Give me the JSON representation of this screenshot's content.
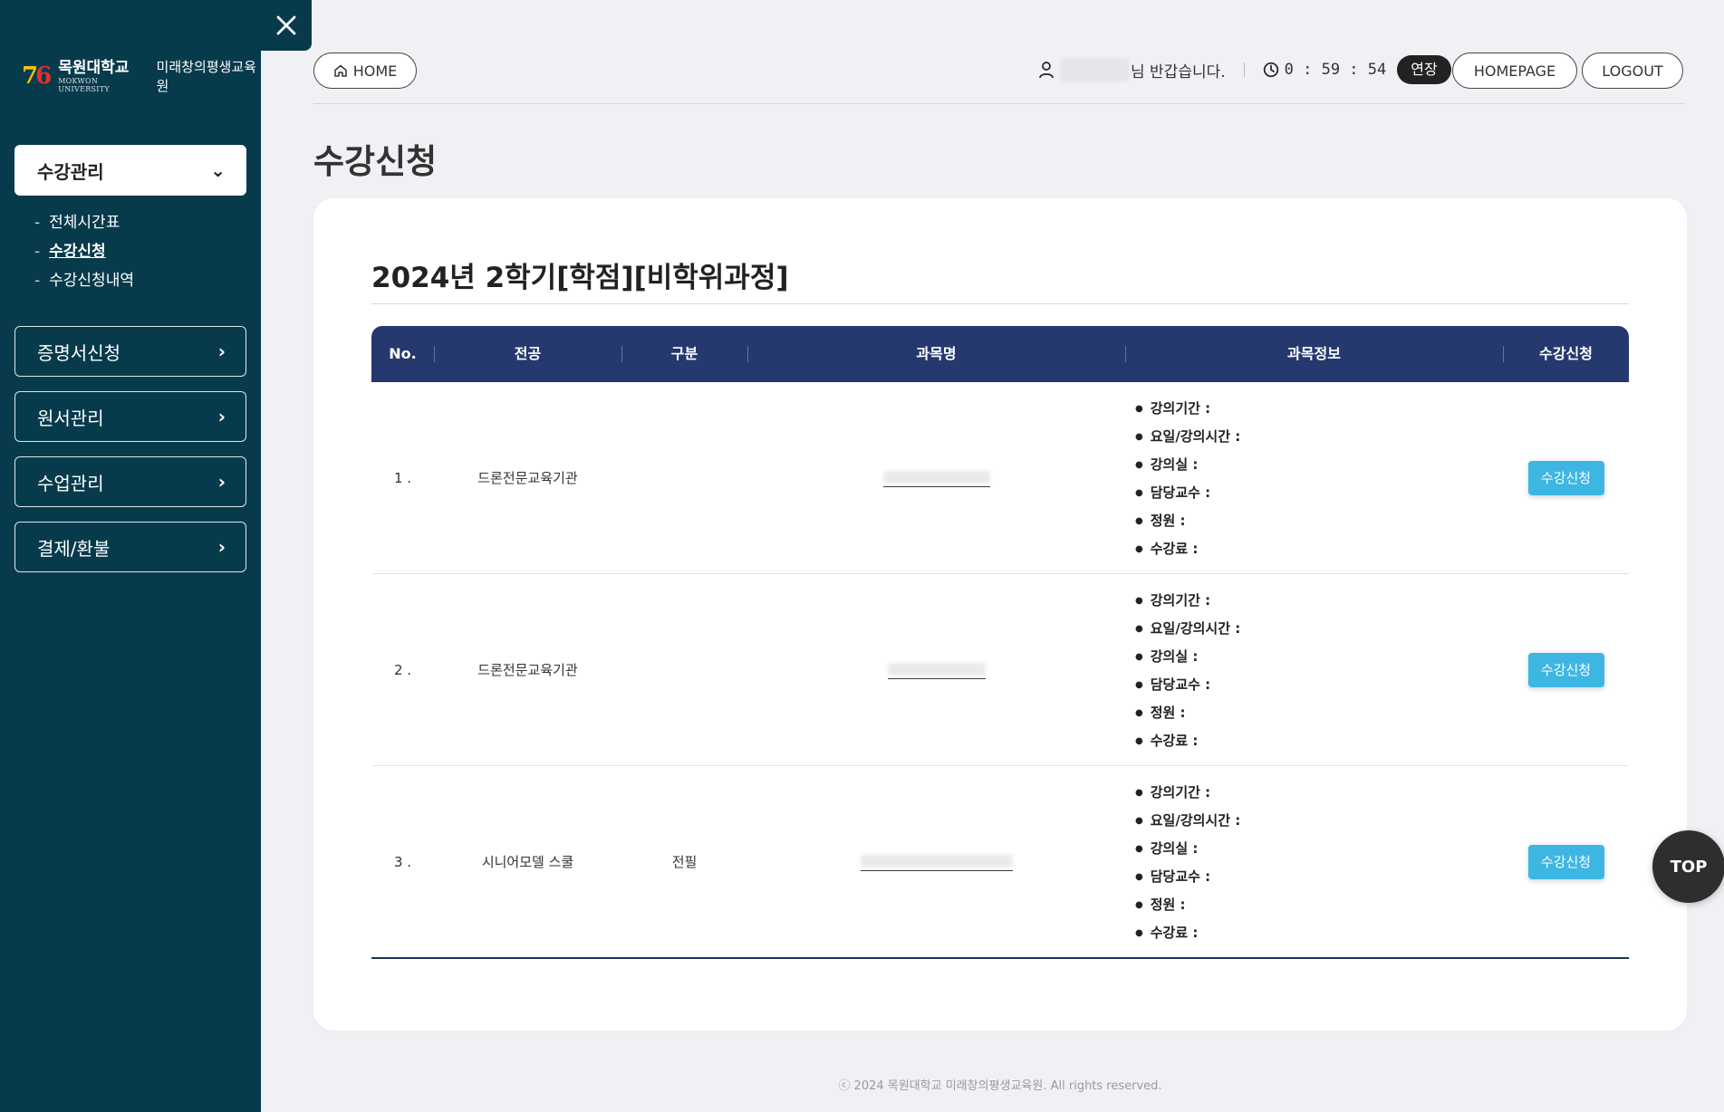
{
  "sidebar": {
    "logo": {
      "mark_left": "7",
      "mark_right": "6",
      "univ_kr": "목원대학교",
      "univ_en": "MOKWON UNIVERSITY",
      "dept": "미래창의평생교육원"
    },
    "menus": [
      {
        "label": "수강관리",
        "active": true
      },
      {
        "label": "증명서신청"
      },
      {
        "label": "원서관리"
      },
      {
        "label": "수업관리"
      },
      {
        "label": "결제/환불"
      }
    ],
    "submenu": [
      {
        "label": "전체시간표"
      },
      {
        "label": "수강신청",
        "current": true
      },
      {
        "label": "수강신청내역"
      }
    ]
  },
  "header": {
    "home_label": "HOME",
    "greeting": "님 반갑습니다.",
    "timer": "0 : 59 : 54",
    "extend_label": "연장",
    "homepage_label": "HOMEPAGE",
    "logout_label": "LOGOUT"
  },
  "page": {
    "title": "수강신청",
    "section_title": "2024년 2학기[학점][비학위과정]"
  },
  "table": {
    "columns": [
      "No.",
      "전공",
      "구분",
      "과목명",
      "과목정보",
      "수강신청"
    ],
    "info_labels": [
      "강의기간 :",
      "요일/강의시간 :",
      "강의실 :",
      "담당교수 :",
      "정원 :",
      "수강료 :"
    ],
    "rows": [
      {
        "no": "1 .",
        "major": "드론전문교육기관",
        "category": "",
        "apply_label": "수강신청"
      },
      {
        "no": "2 .",
        "major": "드론전문교육기관",
        "category": "",
        "apply_label": "수강신청"
      },
      {
        "no": "3 .",
        "major": "시니어모델 스쿨",
        "category": "전필",
        "apply_label": "수강신청"
      }
    ]
  },
  "footer": {
    "copyright": "ⓒ 2024 목원대학교 미래창의평생교육원. All rights reserved."
  },
  "top_button": "TOP",
  "colors": {
    "sidebar": "#073b4c",
    "table_header": "#25396f",
    "apply_button": "#3db6e3"
  }
}
